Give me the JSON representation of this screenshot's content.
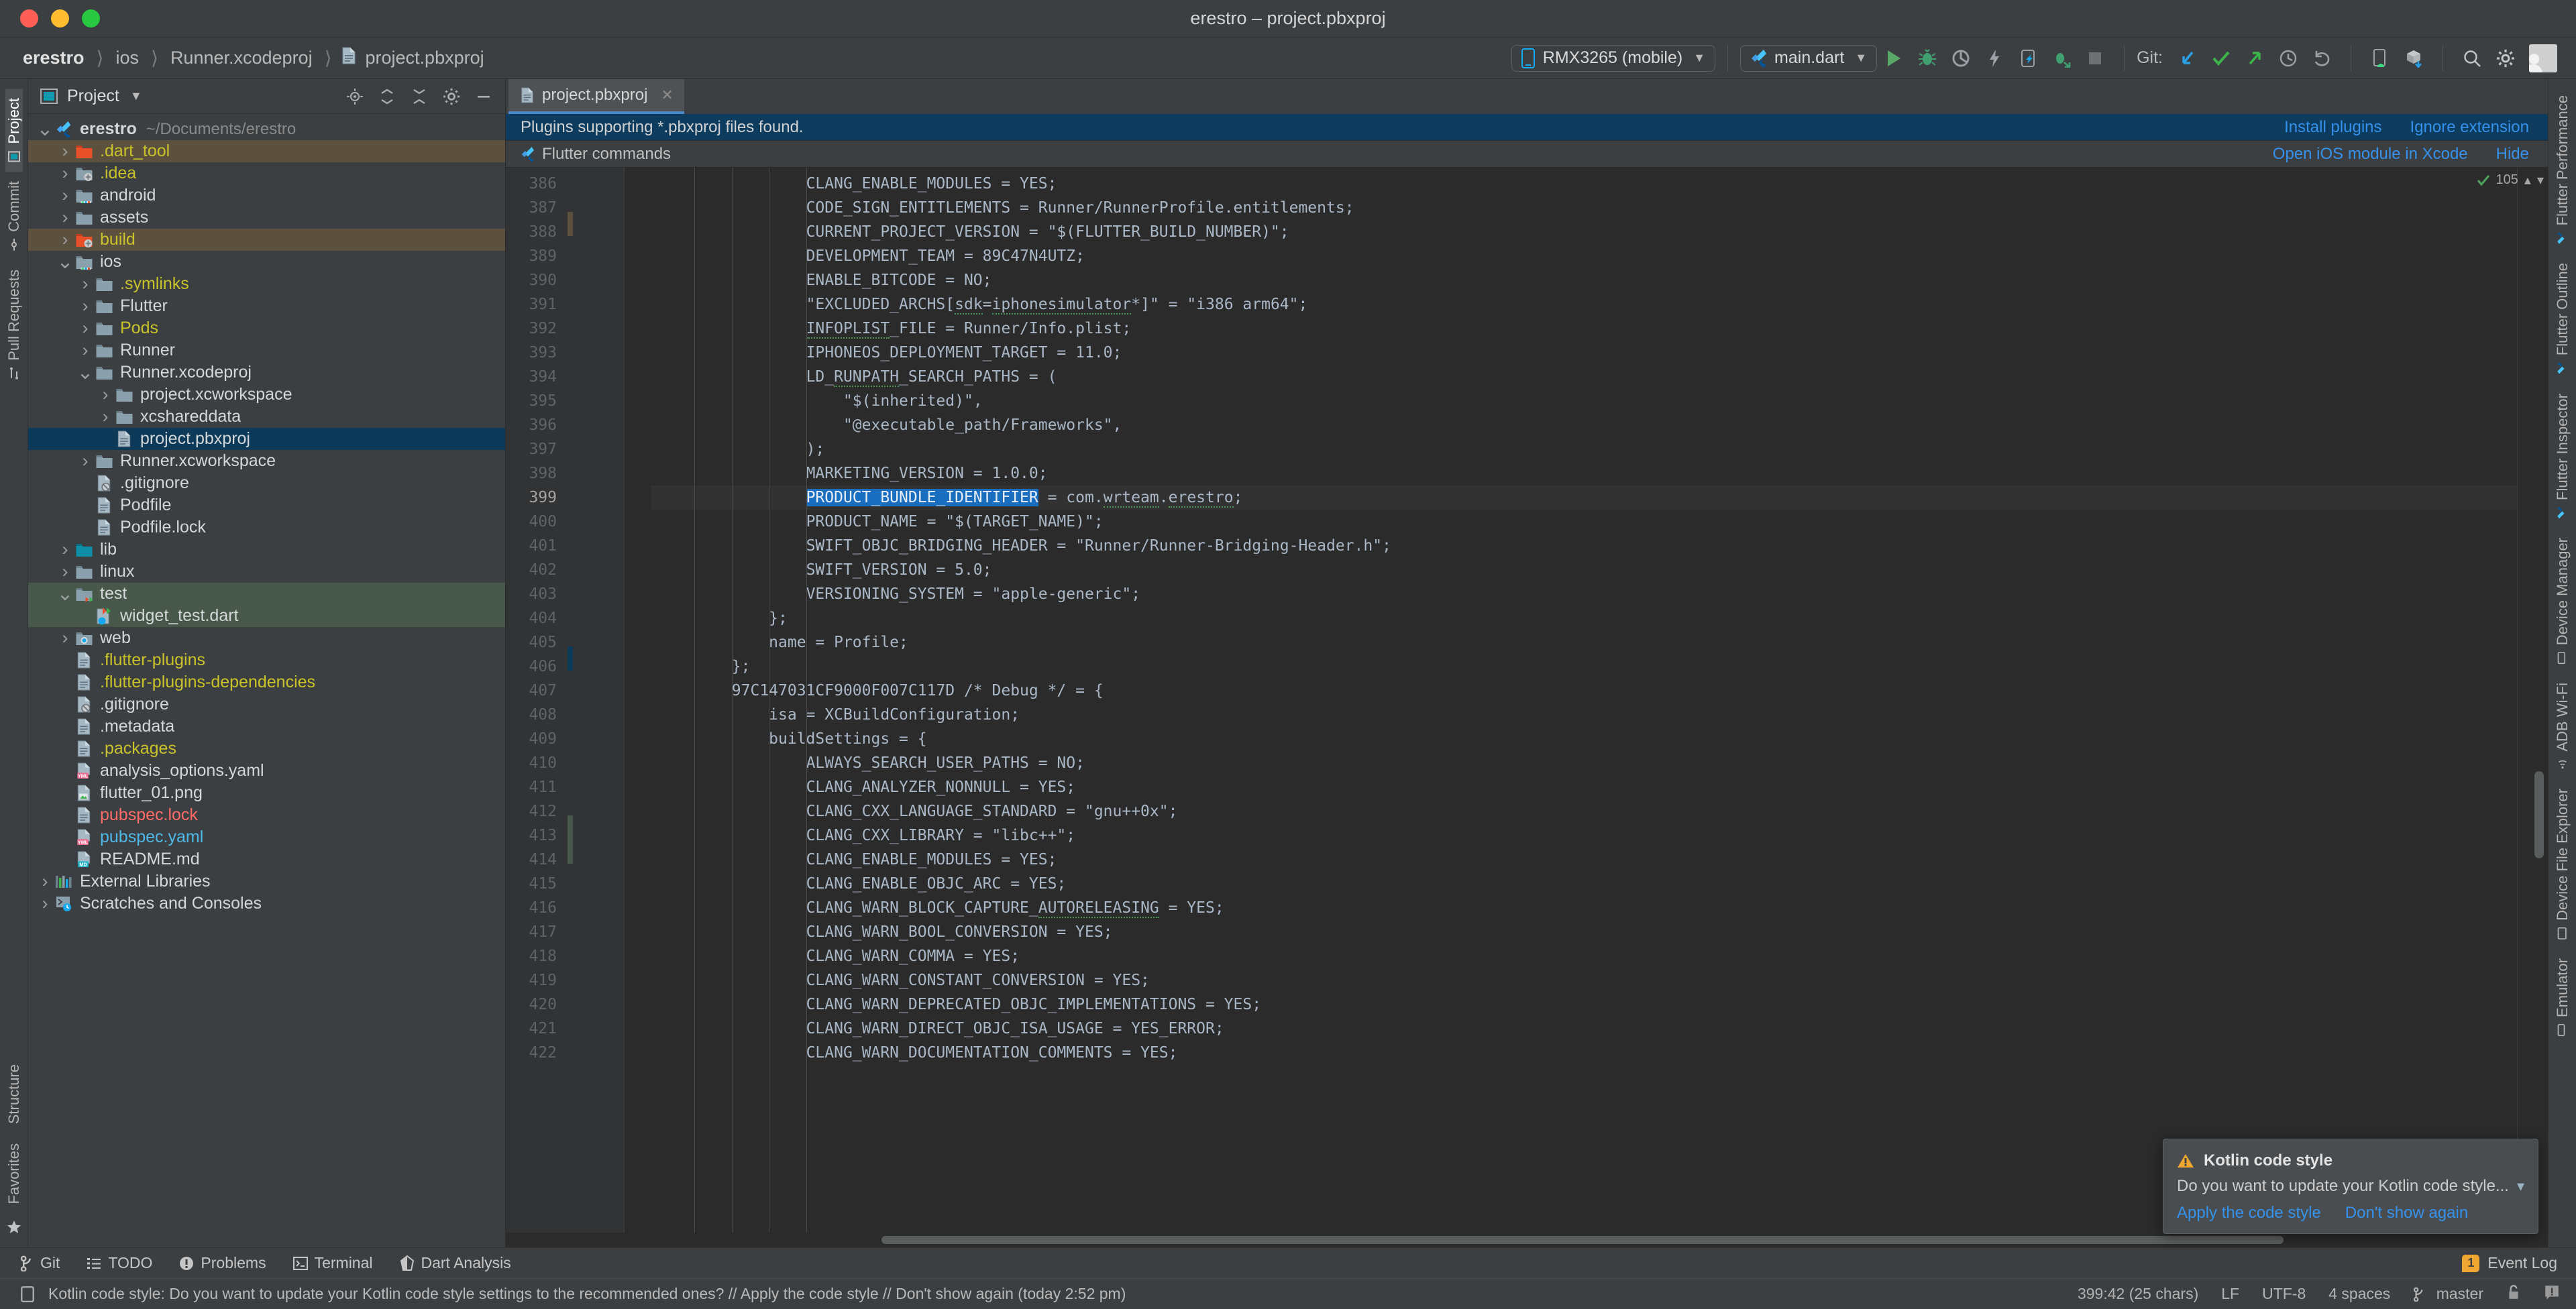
{
  "window": {
    "title": "erestro – project.pbxproj"
  },
  "breadcrumb": {
    "items": [
      "erestro",
      "ios",
      "Runner.xcodeproj",
      "project.pbxproj"
    ],
    "separator": "〉"
  },
  "toolbar": {
    "device_selector": "RMX3265 (mobile)",
    "config_selector": "main.dart",
    "git_label": "Git:",
    "icons": [
      "run-icon",
      "debug-icon",
      "profile-icon",
      "hot-reload-icon",
      "open-devtools-icon",
      "run-with-coverage-icon",
      "stop-icon"
    ],
    "git_icons": [
      "update-project-icon",
      "commit-icon",
      "push-icon",
      "history-icon",
      "rollback-icon"
    ],
    "right_icons": [
      "avd-manager-icon",
      "sdk-manager-icon",
      "search-icon",
      "gear-icon",
      "avatar"
    ]
  },
  "project_pane": {
    "title": "Project",
    "header_icons": [
      "locate-icon",
      "collapse-all-icon",
      "expand-all-icon",
      "settings-icon",
      "hide-icon"
    ],
    "tree": [
      {
        "depth": 0,
        "arrow": "down",
        "icon": "flutter-icon",
        "label": "erestro",
        "sub": "~/Documents/erestro",
        "color": "white",
        "bold": true
      },
      {
        "depth": 1,
        "arrow": "right",
        "icon": "folder-excluded-icon",
        "label": ".dart_tool",
        "color": "yellow",
        "row": "brown"
      },
      {
        "depth": 1,
        "arrow": "right",
        "icon": "folder-idea-icon",
        "label": ".idea",
        "color": "yellow"
      },
      {
        "depth": 1,
        "arrow": "right",
        "icon": "folder-android-icon",
        "label": "android",
        "color": "white"
      },
      {
        "depth": 1,
        "arrow": "right",
        "icon": "folder-icon",
        "label": "assets",
        "color": "white"
      },
      {
        "depth": 1,
        "arrow": "right",
        "icon": "folder-excluded-build-icon",
        "label": "build",
        "color": "yellow",
        "row": "brown"
      },
      {
        "depth": 1,
        "arrow": "down",
        "icon": "folder-ios-icon",
        "label": "ios",
        "color": "white"
      },
      {
        "depth": 2,
        "arrow": "right",
        "icon": "folder-icon",
        "label": ".symlinks",
        "color": "yellow"
      },
      {
        "depth": 2,
        "arrow": "right",
        "icon": "folder-icon",
        "label": "Flutter",
        "color": "white"
      },
      {
        "depth": 2,
        "arrow": "right",
        "icon": "folder-icon",
        "label": "Pods",
        "color": "yellow"
      },
      {
        "depth": 2,
        "arrow": "right",
        "icon": "folder-icon",
        "label": "Runner",
        "color": "white"
      },
      {
        "depth": 2,
        "arrow": "down",
        "icon": "folder-icon",
        "label": "Runner.xcodeproj",
        "color": "white"
      },
      {
        "depth": 3,
        "arrow": "right",
        "icon": "folder-icon",
        "label": "project.xcworkspace",
        "color": "white"
      },
      {
        "depth": 3,
        "arrow": "right",
        "icon": "folder-icon",
        "label": "xcshareddata",
        "color": "white"
      },
      {
        "depth": 3,
        "arrow": "none",
        "icon": "file-icon",
        "label": "project.pbxproj",
        "color": "white",
        "row": "selected"
      },
      {
        "depth": 2,
        "arrow": "right",
        "icon": "folder-icon",
        "label": "Runner.xcworkspace",
        "color": "white"
      },
      {
        "depth": 2,
        "arrow": "none",
        "icon": "file-ignored-icon",
        "label": ".gitignore",
        "color": "white"
      },
      {
        "depth": 2,
        "arrow": "none",
        "icon": "file-icon",
        "label": "Podfile",
        "color": "white"
      },
      {
        "depth": 2,
        "arrow": "none",
        "icon": "file-icon",
        "label": "Podfile.lock",
        "color": "white"
      },
      {
        "depth": 1,
        "arrow": "right",
        "icon": "folder-source-icon",
        "label": "lib",
        "color": "white"
      },
      {
        "depth": 1,
        "arrow": "right",
        "icon": "folder-icon",
        "label": "linux",
        "color": "white"
      },
      {
        "depth": 1,
        "arrow": "down",
        "icon": "folder-test-icon",
        "label": "test",
        "color": "white",
        "row": "green"
      },
      {
        "depth": 2,
        "arrow": "none",
        "icon": "dart-test-file-icon",
        "label": "widget_test.dart",
        "color": "white",
        "row": "green"
      },
      {
        "depth": 1,
        "arrow": "right",
        "icon": "folder-web-icon",
        "label": "web",
        "color": "white"
      },
      {
        "depth": 1,
        "arrow": "none",
        "icon": "file-icon",
        "label": ".flutter-plugins",
        "color": "yellow"
      },
      {
        "depth": 1,
        "arrow": "none",
        "icon": "file-icon",
        "label": ".flutter-plugins-dependencies",
        "color": "yellow"
      },
      {
        "depth": 1,
        "arrow": "none",
        "icon": "file-ignored-icon",
        "label": ".gitignore",
        "color": "white"
      },
      {
        "depth": 1,
        "arrow": "none",
        "icon": "file-icon",
        "label": ".metadata",
        "color": "white"
      },
      {
        "depth": 1,
        "arrow": "none",
        "icon": "file-icon",
        "label": ".packages",
        "color": "yellow"
      },
      {
        "depth": 1,
        "arrow": "none",
        "icon": "yaml-file-icon",
        "label": "analysis_options.yaml",
        "color": "white"
      },
      {
        "depth": 1,
        "arrow": "none",
        "icon": "image-file-icon",
        "label": "flutter_01.png",
        "color": "white"
      },
      {
        "depth": 1,
        "arrow": "none",
        "icon": "file-icon",
        "label": "pubspec.lock",
        "color": "red"
      },
      {
        "depth": 1,
        "arrow": "none",
        "icon": "yaml-file-icon",
        "label": "pubspec.yaml",
        "color": "cyan"
      },
      {
        "depth": 1,
        "arrow": "none",
        "icon": "markdown-file-icon",
        "label": "README.md",
        "color": "white"
      },
      {
        "depth": 0,
        "arrow": "right",
        "icon": "external-libraries-icon",
        "label": "External Libraries",
        "color": "white"
      },
      {
        "depth": 0,
        "arrow": "right",
        "icon": "scratches-icon",
        "label": "Scratches and Consoles",
        "color": "white"
      }
    ]
  },
  "left_strip": {
    "tabs": [
      "Project",
      "Commit",
      "Pull Requests"
    ],
    "bottom_tabs": [
      "Structure",
      "Favorites"
    ]
  },
  "right_strip": {
    "tabs": [
      "Flutter Performance",
      "Flutter Outline",
      "Flutter Inspector",
      "Device Manager",
      "ADB Wi-Fi",
      "Device File Explorer",
      "Emulator"
    ]
  },
  "editor": {
    "tab_label": "project.pbxproj",
    "banner1": {
      "message": "Plugins supporting *.pbxproj files found.",
      "actions": [
        "Install plugins",
        "Ignore extension"
      ]
    },
    "banner2": {
      "message": "Flutter commands",
      "actions": [
        "Open iOS module in Xcode",
        "Hide"
      ]
    },
    "inspection_count": "105",
    "first_line_number": 386,
    "current_line": 399,
    "selection": "PRODUCT_BUNDLE_IDENTIFIER",
    "lines": [
      {
        "n": 386,
        "indent": 4,
        "text": "CLANG_ENABLE_MODULES = YES;"
      },
      {
        "n": 387,
        "indent": 4,
        "text": "CODE_SIGN_ENTITLEMENTS = Runner/RunnerProfile.entitlements;"
      },
      {
        "n": 388,
        "indent": 4,
        "text": "CURRENT_PROJECT_VERSION = \"$(FLUTTER_BUILD_NUMBER)\";"
      },
      {
        "n": 389,
        "indent": 4,
        "text": "DEVELOPMENT_TEAM = 89C47N4UTZ;"
      },
      {
        "n": 390,
        "indent": 4,
        "text": "ENABLE_BITCODE = NO;"
      },
      {
        "n": 391,
        "indent": 4,
        "text": "\"EXCLUDED_ARCHS[sdk=iphonesimulator*]\" = \"i386 arm64\";"
      },
      {
        "n": 392,
        "indent": 4,
        "text": "INFOPLIST_FILE = Runner/Info.plist;"
      },
      {
        "n": 393,
        "indent": 4,
        "text": "IPHONEOS_DEPLOYMENT_TARGET = 11.0;"
      },
      {
        "n": 394,
        "indent": 4,
        "text": "LD_RUNPATH_SEARCH_PATHS = ("
      },
      {
        "n": 395,
        "indent": 5,
        "text": "\"$(inherited)\","
      },
      {
        "n": 396,
        "indent": 5,
        "text": "\"@executable_path/Frameworks\","
      },
      {
        "n": 397,
        "indent": 4,
        "text": ");"
      },
      {
        "n": 398,
        "indent": 4,
        "text": "MARKETING_VERSION = 1.0.0;"
      },
      {
        "n": 399,
        "indent": 4,
        "text": "PRODUCT_BUNDLE_IDENTIFIER = com.wrteam.erestro;"
      },
      {
        "n": 400,
        "indent": 4,
        "text": "PRODUCT_NAME = \"$(TARGET_NAME)\";"
      },
      {
        "n": 401,
        "indent": 4,
        "text": "SWIFT_OBJC_BRIDGING_HEADER = \"Runner/Runner-Bridging-Header.h\";"
      },
      {
        "n": 402,
        "indent": 4,
        "text": "SWIFT_VERSION = 5.0;"
      },
      {
        "n": 403,
        "indent": 4,
        "text": "VERSIONING_SYSTEM = \"apple-generic\";"
      },
      {
        "n": 404,
        "indent": 3,
        "text": "};"
      },
      {
        "n": 405,
        "indent": 3,
        "text": "name = Profile;"
      },
      {
        "n": 406,
        "indent": 2,
        "text": "};"
      },
      {
        "n": 407,
        "indent": 2,
        "text": "97C147031CF9000F007C117D /* Debug */ = {"
      },
      {
        "n": 408,
        "indent": 3,
        "text": "isa = XCBuildConfiguration;"
      },
      {
        "n": 409,
        "indent": 3,
        "text": "buildSettings = {"
      },
      {
        "n": 410,
        "indent": 4,
        "text": "ALWAYS_SEARCH_USER_PATHS = NO;"
      },
      {
        "n": 411,
        "indent": 4,
        "text": "CLANG_ANALYZER_NONNULL = YES;"
      },
      {
        "n": 412,
        "indent": 4,
        "text": "CLANG_CXX_LANGUAGE_STANDARD = \"gnu++0x\";"
      },
      {
        "n": 413,
        "indent": 4,
        "text": "CLANG_CXX_LIBRARY = \"libc++\";"
      },
      {
        "n": 414,
        "indent": 4,
        "text": "CLANG_ENABLE_MODULES = YES;"
      },
      {
        "n": 415,
        "indent": 4,
        "text": "CLANG_ENABLE_OBJC_ARC = YES;"
      },
      {
        "n": 416,
        "indent": 4,
        "text": "CLANG_WARN_BLOCK_CAPTURE_AUTORELEASING = YES;"
      },
      {
        "n": 417,
        "indent": 4,
        "text": "CLANG_WARN_BOOL_CONVERSION = YES;"
      },
      {
        "n": 418,
        "indent": 4,
        "text": "CLANG_WARN_COMMA = YES;"
      },
      {
        "n": 419,
        "indent": 4,
        "text": "CLANG_WARN_CONSTANT_CONVERSION = YES;"
      },
      {
        "n": 420,
        "indent": 4,
        "text": "CLANG_WARN_DEPRECATED_OBJC_IMPLEMENTATIONS = YES;"
      },
      {
        "n": 421,
        "indent": 4,
        "text": "CLANG_WARN_DIRECT_OBJC_ISA_USAGE = YES_ERROR;"
      },
      {
        "n": 422,
        "indent": 4,
        "text": "CLANG_WARN_DOCUMENTATION_COMMENTS = YES;"
      }
    ]
  },
  "notification": {
    "title": "Kotlin code style",
    "message": "Do you want to update your Kotlin code style...",
    "actions": [
      "Apply the code style",
      "Don't show again"
    ]
  },
  "bottom_bar": {
    "items": [
      {
        "label": "Git",
        "icon": "git-branch-icon"
      },
      {
        "label": "TODO",
        "icon": "todo-icon"
      },
      {
        "label": "Problems",
        "icon": "problems-icon"
      },
      {
        "label": "Terminal",
        "icon": "terminal-icon"
      },
      {
        "label": "Dart Analysis",
        "icon": "dart-icon"
      }
    ],
    "event_log": {
      "label": "Event Log",
      "count": "1"
    }
  },
  "status_bar": {
    "message": "Kotlin code style: Do you want to update your Kotlin code style settings to the recommended ones? // Apply the code style // Don't show again (today 2:52 pm)",
    "caret": "399:42 (25 chars)",
    "line_separator": "LF",
    "encoding": "UTF-8",
    "indent": "4 spaces",
    "branch": "master",
    "icons": [
      "lock-icon",
      "notifications-icon"
    ]
  },
  "colors": {
    "accent_blue": "#3592ec",
    "banner_bg": "#0d3c5f",
    "selection_blue": "#1a6ec0",
    "tree_selected": "#0d3a58",
    "warn_orange": "#f0a732",
    "green": "#499c54"
  }
}
